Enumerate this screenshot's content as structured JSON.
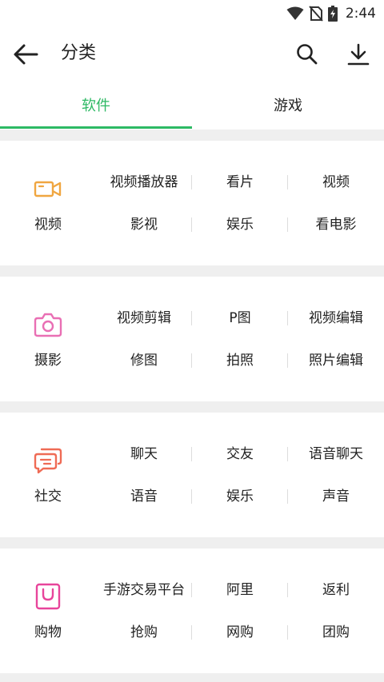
{
  "status_bar": {
    "time": "2:44",
    "icons": [
      "wifi-icon",
      "no-sim-icon",
      "battery-charging-icon"
    ]
  },
  "app_bar": {
    "title": "分类",
    "back_icon": "arrow-left-icon",
    "search_icon": "search-icon",
    "download_icon": "download-icon"
  },
  "tabs": [
    {
      "label": "软件",
      "active": true
    },
    {
      "label": "游戏",
      "active": false
    }
  ],
  "colors": {
    "accent": "#2db964",
    "video": "#f0a640",
    "photo": "#e96fb4",
    "social": "#ef6b55",
    "shopping": "#e8459b"
  },
  "categories": [
    {
      "name": "视频",
      "icon": "video-camera-icon",
      "tags": [
        "视频播放器",
        "看片",
        "视频",
        "影视",
        "娱乐",
        "看电影"
      ]
    },
    {
      "name": "摄影",
      "icon": "camera-icon",
      "tags": [
        "视频剪辑",
        "P图",
        "视频编辑",
        "修图",
        "拍照",
        "照片编辑"
      ]
    },
    {
      "name": "社交",
      "icon": "chat-bubbles-icon",
      "tags": [
        "聊天",
        "交友",
        "语音聊天",
        "语音",
        "娱乐",
        "声音"
      ]
    },
    {
      "name": "购物",
      "icon": "shopping-bag-icon",
      "tags": [
        "手游交易平台",
        "阿里",
        "返利",
        "抢购",
        "网购",
        "团购"
      ]
    }
  ]
}
